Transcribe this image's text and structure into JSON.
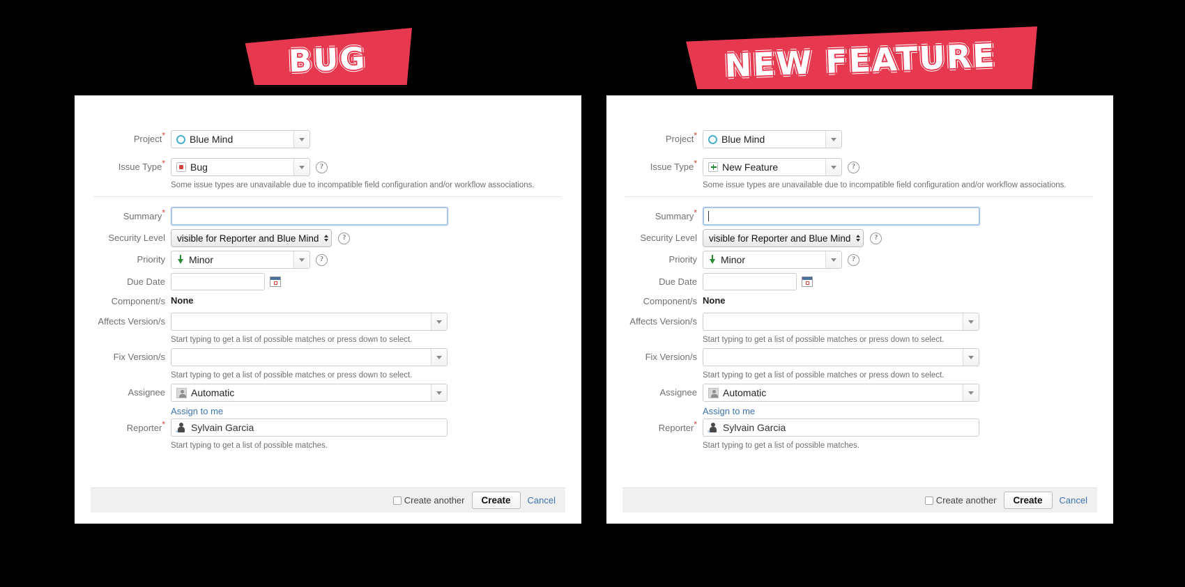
{
  "banners": {
    "left": "BUG",
    "right": "NEW FEATURE",
    "color": "#e63950"
  },
  "forms": [
    {
      "id": "bug",
      "fields": {
        "project_label": "Project",
        "project_value": "Blue Mind",
        "project_icon": "project-circle-icon",
        "issue_type_label": "Issue Type",
        "issue_type_value": "Bug",
        "issue_type_icon": "bug-icon",
        "issue_type_note": "Some issue types are unavailable due to incompatible field configuration and/or workflow associations.",
        "summary_label": "Summary",
        "summary_value": "",
        "security_level_label": "Security Level",
        "security_level_value": "visible for Reporter and Blue Mind",
        "priority_label": "Priority",
        "priority_value": "Minor",
        "priority_icon": "arrow-down-green-icon",
        "due_date_label": "Due Date",
        "due_date_value": "",
        "due_date_icon": "calendar-icon",
        "components_label": "Component/s",
        "components_value": "None",
        "affects_versions_label": "Affects Version/s",
        "affects_versions_value": "",
        "affects_versions_help": "Start typing to get a list of possible matches or press down to select.",
        "fix_versions_label": "Fix Version/s",
        "fix_versions_value": "",
        "fix_versions_help": "Start typing to get a list of possible matches or press down to select.",
        "assignee_label": "Assignee",
        "assignee_value": "Automatic",
        "assignee_icon": "avatar-icon",
        "assign_to_me": "Assign to me",
        "reporter_label": "Reporter",
        "reporter_value": "Sylvain Garcia",
        "reporter_icon": "person-icon",
        "reporter_help": "Start typing to get a list of possible matches."
      },
      "footer": {
        "create_another": "Create another",
        "create": "Create",
        "cancel": "Cancel"
      }
    },
    {
      "id": "feature",
      "fields": {
        "project_label": "Project",
        "project_value": "Blue Mind",
        "project_icon": "project-circle-icon",
        "issue_type_label": "Issue Type",
        "issue_type_value": "New Feature",
        "issue_type_icon": "new-feature-plus-icon",
        "issue_type_note": "Some issue types are unavailable due to incompatible field configuration and/or workflow associations.",
        "summary_label": "Summary",
        "summary_value": "",
        "security_level_label": "Security Level",
        "security_level_value": "visible for Reporter and Blue Mind",
        "priority_label": "Priority",
        "priority_value": "Minor",
        "priority_icon": "arrow-down-green-icon",
        "due_date_label": "Due Date",
        "due_date_value": "",
        "due_date_icon": "calendar-icon",
        "components_label": "Component/s",
        "components_value": "None",
        "affects_versions_label": "Affects Version/s",
        "affects_versions_value": "",
        "affects_versions_help": "Start typing to get a list of possible matches or press down to select.",
        "fix_versions_label": "Fix Version/s",
        "fix_versions_value": "",
        "fix_versions_help": "Start typing to get a list of possible matches or press down to select.",
        "assignee_label": "Assignee",
        "assignee_value": "Automatic",
        "assignee_icon": "avatar-icon",
        "assign_to_me": "Assign to me",
        "reporter_label": "Reporter",
        "reporter_value": "Sylvain Garcia",
        "reporter_icon": "person-icon",
        "reporter_help": "Start typing to get a list of possible matches."
      },
      "footer": {
        "create_another": "Create another",
        "create": "Create",
        "cancel": "Cancel"
      }
    }
  ]
}
